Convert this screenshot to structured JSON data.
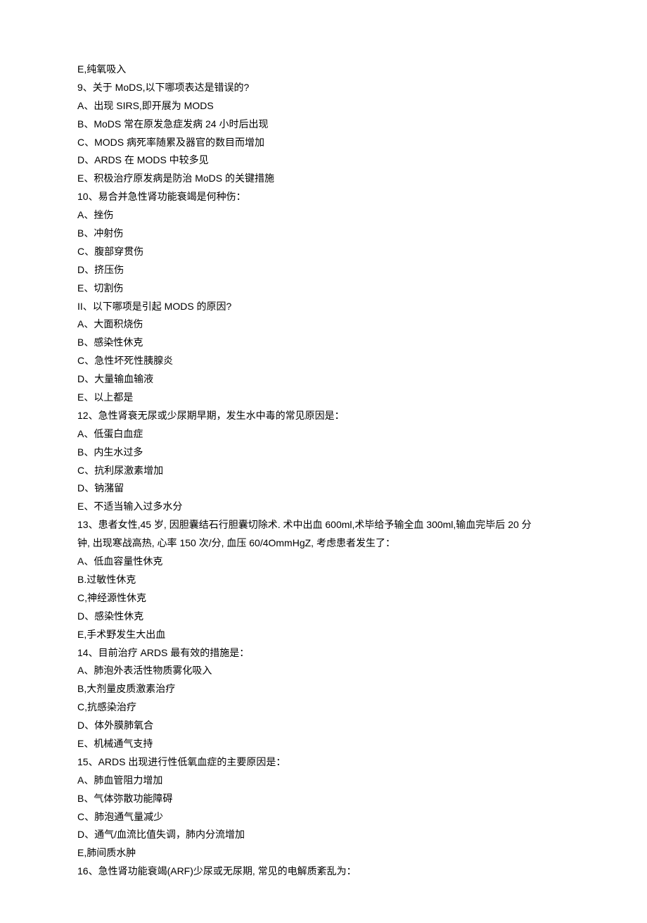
{
  "lines": [
    "E,纯氧吸入",
    "9、关于 MoDS,以下哪项表达是错误的?",
    "A、出现 SIRS,即开展为 MODS",
    "B、MoDS 常在原发急症发病 24 小时后出现",
    "C、MODS 病死率随累及器官的数目而增加",
    "D、ARDS 在 MODS 中较多见",
    "E、积极治疗原发病是防治 MoDS 的关键措施",
    "10、易合并急性肾功能衰竭是何种伤：",
    "A、挫伤",
    "B、冲射伤",
    "C、腹部穿贯伤",
    "D、挤压伤",
    "E、切割伤",
    "II、以下哪项是引起 MODS 的原因?",
    "A、大面积烧伤",
    "B、感染性休克",
    "C、急性坏死性胰腺炎",
    "D、大量输血输液",
    "E、以上都是",
    "12、急性肾衰无尿或少尿期早期，发生水中毒的常见原因是：",
    "A、低蛋白血症",
    "B、内生水过多",
    "C、抗利尿激素增加",
    "D、钠潴留",
    "E、不适当输入过多水分",
    "13、患者女性,45 岁, 因胆囊结石行胆囊切除术. 术中出血 600ml,术毕给予输全血 300ml,输血完毕后 20 分",
    "钟, 出现寒战高热, 心率 150 次/分, 血压 60/4OmmHgZ, 考虑患者发生了：",
    "A、低血容量性休克",
    "B.过敏性休克",
    "C,神经源性休克",
    "D、感染性休克",
    "E,手术野发生大出血",
    "14、目前治疗 ARDS 最有效的措施是：",
    "A、肺泡外表活性物质雾化吸入",
    "B,大剂量皮质激素治疗",
    "C,抗感染治疗",
    "D、体外膜肺氧合",
    "E、机械通气支持",
    "15、ARDS 出现进行性低氧血症的主要原因是：",
    "A、肺血管阻力增加",
    "B、气体弥散功能障碍",
    "C、肺泡通气量减少",
    "D、通气/血流比值失调，肺内分流增加",
    "E,肺间质水肿",
    "16、急性肾功能衰竭(ARF)少尿或无尿期, 常见的电解质紊乱为："
  ]
}
